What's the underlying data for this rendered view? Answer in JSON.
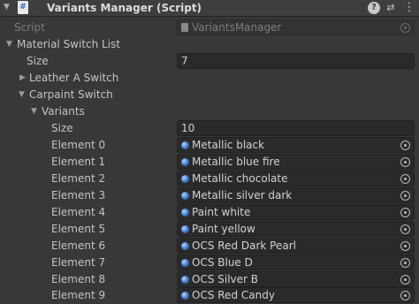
{
  "header": {
    "title": "Variants Manager (Script)",
    "enabled_checkbox": "✓",
    "script_icon": "#",
    "help_label": "?",
    "presets_label": "⇄",
    "menu_label": "⋮"
  },
  "script_field": {
    "label": "Script",
    "value": "VariantsManager"
  },
  "material_switch_list": {
    "label": "Material Switch List",
    "size_label": "Size",
    "size_value": "7",
    "leather": {
      "label": "Leather A Switch"
    },
    "carpaint": {
      "label": "Carpaint Switch",
      "variants": {
        "label": "Variants",
        "size_label": "Size",
        "size_value": "10",
        "elements": [
          {
            "label": "Element 0",
            "value": "Metallic black"
          },
          {
            "label": "Element 1",
            "value": "Metallic blue fire"
          },
          {
            "label": "Element 2",
            "value": "Metallic chocolate"
          },
          {
            "label": "Element 3",
            "value": "Metallic silver dark"
          },
          {
            "label": "Element 4",
            "value": "Paint white"
          },
          {
            "label": "Element 5",
            "value": "Paint yellow"
          },
          {
            "label": "Element 6",
            "value": "OCS Red Dark Pearl"
          },
          {
            "label": "Element 7",
            "value": "OCS Blue D"
          },
          {
            "label": "Element 8",
            "value": "OCS Silver B"
          },
          {
            "label": "Element 9",
            "value": "OCS Red Candy"
          }
        ]
      }
    }
  },
  "colors": {
    "background": "#383838",
    "field": "#2a2a2a",
    "text": "#c4c4c4",
    "object_icon": "#4a86d6"
  },
  "icons": {
    "foldout_open": "▼",
    "foldout_closed": "▶",
    "object_picker": "object-picker-icon",
    "material": "material-icon"
  }
}
